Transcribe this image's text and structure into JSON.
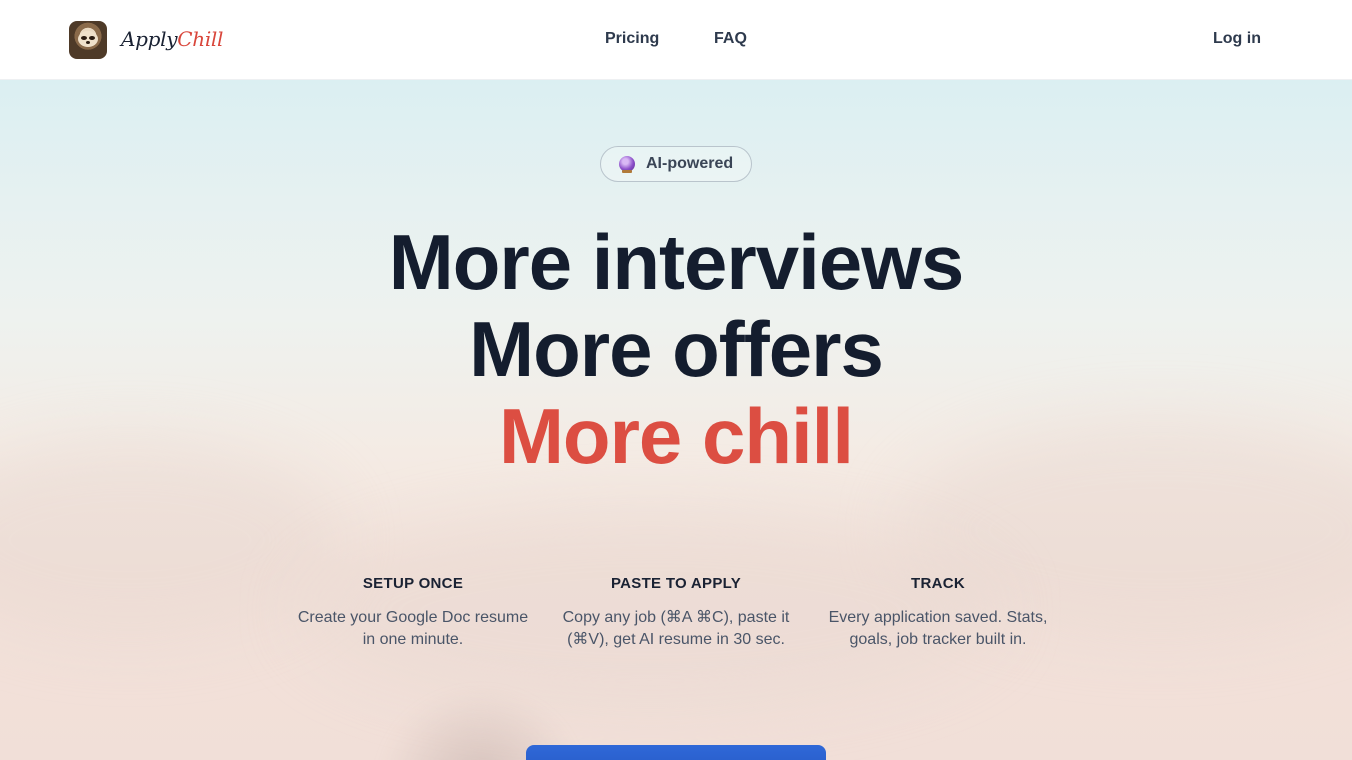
{
  "brand": {
    "name_part1": "Apply",
    "name_part2": "Chill",
    "logo_icon": "sloth-avatar",
    "accent_color": "#d9463b"
  },
  "nav": {
    "items": [
      {
        "label": "Pricing"
      },
      {
        "label": "FAQ"
      }
    ],
    "login_label": "Log in"
  },
  "hero": {
    "badge_icon": "crystal-ball-icon",
    "badge_label": "AI-powered",
    "headline_lines": [
      "More interviews",
      "More offers",
      "More chill"
    ],
    "headline_accent_color": "#dc4e42"
  },
  "features": [
    {
      "title": "SETUP ONCE",
      "desc": "Create your Google Doc resume in one minute."
    },
    {
      "title": "PASTE TO APPLY",
      "desc": "Copy any job (⌘A ⌘C), paste it (⌘V), get AI resume in 30 sec."
    },
    {
      "title": "TRACK",
      "desc": "Every application saved. Stats, goals, job tracker built in."
    }
  ],
  "cta": {
    "color": "#2a5fcc"
  }
}
